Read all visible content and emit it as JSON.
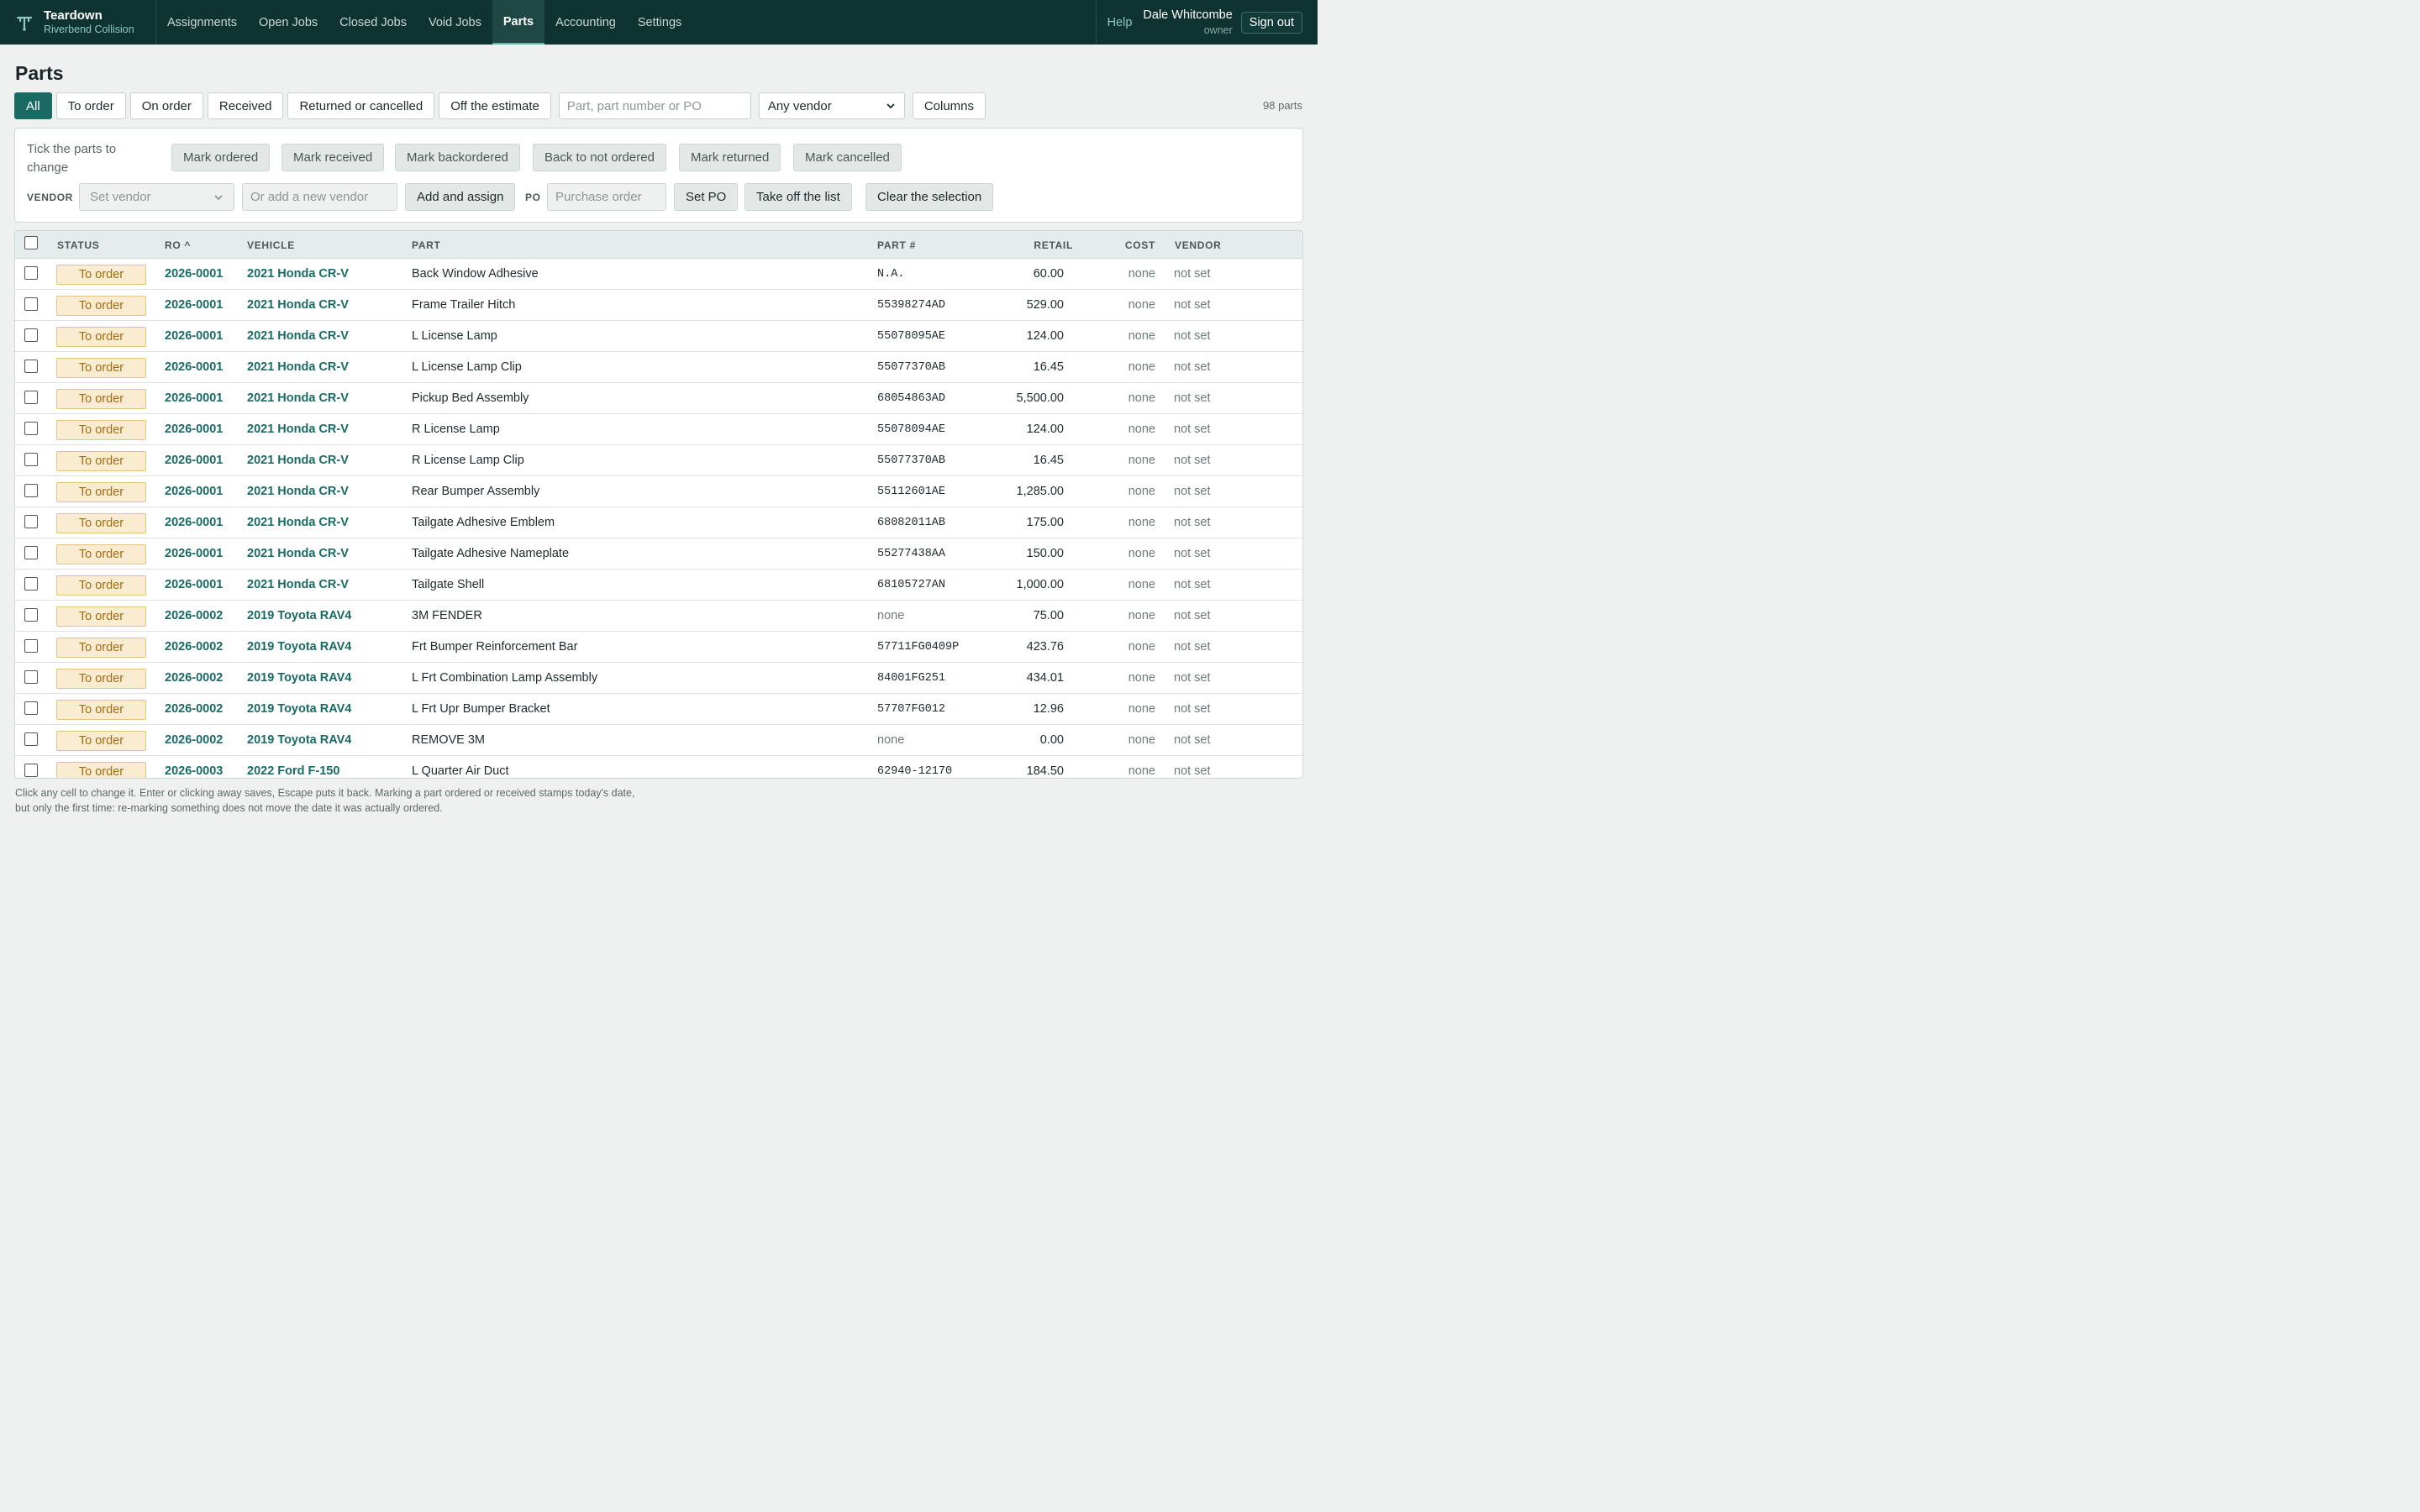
{
  "app": {
    "name": "Teardown",
    "shop": "Riverbend Collision"
  },
  "nav": [
    {
      "label": "Assignments",
      "active": false
    },
    {
      "label": "Open Jobs",
      "active": false
    },
    {
      "label": "Closed Jobs",
      "active": false
    },
    {
      "label": "Void Jobs",
      "active": false
    },
    {
      "label": "Parts",
      "active": true
    },
    {
      "label": "Accounting",
      "active": false
    },
    {
      "label": "Settings",
      "active": false
    }
  ],
  "topright": {
    "help": "Help",
    "user_name": "Dale Whitcombe",
    "user_role": "owner",
    "sign_out": "Sign out"
  },
  "page_title": "Parts",
  "filters": {
    "tabs": [
      "All",
      "To order",
      "On order",
      "Received",
      "Returned or cancelled",
      "Off the estimate"
    ],
    "active_tab": "All",
    "search_placeholder": "Part, part number or PO",
    "vendor_select": "Any vendor",
    "columns_button": "Columns",
    "count": "98 parts"
  },
  "bulk": {
    "hint": "Tick the parts to change",
    "actions": [
      "Mark ordered",
      "Mark received",
      "Mark backordered",
      "Back to not ordered",
      "Mark returned",
      "Mark cancelled"
    ],
    "vendor_label": "VENDOR",
    "set_vendor_placeholder": "Set vendor",
    "new_vendor_placeholder": "Or add a new vendor",
    "add_assign": "Add and assign",
    "po_label": "PO",
    "po_placeholder": "Purchase order",
    "set_po": "Set PO",
    "take_off": "Take off the list",
    "clear": "Clear the selection"
  },
  "table": {
    "headers": {
      "status": "STATUS",
      "ro": "RO ^",
      "vehicle": "VEHICLE",
      "part": "PART",
      "part_no": "PART #",
      "retail": "RETAIL",
      "cost": "COST",
      "vendor": "VENDOR"
    },
    "rows": [
      {
        "status": "To order",
        "ro": "2026-0001",
        "vehicle": "2021 Honda CR-V",
        "part": "Back Window Adhesive",
        "part_no": "N.A.",
        "retail": "60.00",
        "cost": "none",
        "vendor": "not set"
      },
      {
        "status": "To order",
        "ro": "2026-0001",
        "vehicle": "2021 Honda CR-V",
        "part": "Frame Trailer Hitch",
        "part_no": "55398274AD",
        "retail": "529.00",
        "cost": "none",
        "vendor": "not set"
      },
      {
        "status": "To order",
        "ro": "2026-0001",
        "vehicle": "2021 Honda CR-V",
        "part": "L License Lamp",
        "part_no": "55078095AE",
        "retail": "124.00",
        "cost": "none",
        "vendor": "not set"
      },
      {
        "status": "To order",
        "ro": "2026-0001",
        "vehicle": "2021 Honda CR-V",
        "part": "L License Lamp Clip",
        "part_no": "55077370AB",
        "retail": "16.45",
        "cost": "none",
        "vendor": "not set"
      },
      {
        "status": "To order",
        "ro": "2026-0001",
        "vehicle": "2021 Honda CR-V",
        "part": "Pickup Bed Assembly",
        "part_no": "68054863AD",
        "retail": "5,500.00",
        "cost": "none",
        "vendor": "not set"
      },
      {
        "status": "To order",
        "ro": "2026-0001",
        "vehicle": "2021 Honda CR-V",
        "part": "R License Lamp",
        "part_no": "55078094AE",
        "retail": "124.00",
        "cost": "none",
        "vendor": "not set"
      },
      {
        "status": "To order",
        "ro": "2026-0001",
        "vehicle": "2021 Honda CR-V",
        "part": "R License Lamp Clip",
        "part_no": "55077370AB",
        "retail": "16.45",
        "cost": "none",
        "vendor": "not set"
      },
      {
        "status": "To order",
        "ro": "2026-0001",
        "vehicle": "2021 Honda CR-V",
        "part": "Rear Bumper Assembly",
        "part_no": "55112601AE",
        "retail": "1,285.00",
        "cost": "none",
        "vendor": "not set"
      },
      {
        "status": "To order",
        "ro": "2026-0001",
        "vehicle": "2021 Honda CR-V",
        "part": "Tailgate Adhesive Emblem",
        "part_no": "68082011AB",
        "retail": "175.00",
        "cost": "none",
        "vendor": "not set"
      },
      {
        "status": "To order",
        "ro": "2026-0001",
        "vehicle": "2021 Honda CR-V",
        "part": "Tailgate Adhesive Nameplate",
        "part_no": "55277438AA",
        "retail": "150.00",
        "cost": "none",
        "vendor": "not set"
      },
      {
        "status": "To order",
        "ro": "2026-0001",
        "vehicle": "2021 Honda CR-V",
        "part": "Tailgate Shell",
        "part_no": "68105727AN",
        "retail": "1,000.00",
        "cost": "none",
        "vendor": "not set"
      },
      {
        "status": "To order",
        "ro": "2026-0002",
        "vehicle": "2019 Toyota RAV4",
        "part": "3M FENDER",
        "part_no": "none",
        "retail": "75.00",
        "cost": "none",
        "vendor": "not set"
      },
      {
        "status": "To order",
        "ro": "2026-0002",
        "vehicle": "2019 Toyota RAV4",
        "part": "Frt Bumper Reinforcement Bar",
        "part_no": "57711FG0409P",
        "retail": "423.76",
        "cost": "none",
        "vendor": "not set"
      },
      {
        "status": "To order",
        "ro": "2026-0002",
        "vehicle": "2019 Toyota RAV4",
        "part": "L Frt Combination Lamp Assembly",
        "part_no": "84001FG251",
        "retail": "434.01",
        "cost": "none",
        "vendor": "not set"
      },
      {
        "status": "To order",
        "ro": "2026-0002",
        "vehicle": "2019 Toyota RAV4",
        "part": "L Frt Upr Bumper Bracket",
        "part_no": "57707FG012",
        "retail": "12.96",
        "cost": "none",
        "vendor": "not set"
      },
      {
        "status": "To order",
        "ro": "2026-0002",
        "vehicle": "2019 Toyota RAV4",
        "part": "REMOVE 3M",
        "part_no": "none",
        "retail": "0.00",
        "cost": "none",
        "vendor": "not set"
      },
      {
        "status": "To order",
        "ro": "2026-0003",
        "vehicle": "2022 Ford F-150",
        "part": "L Quarter Air Duct",
        "part_no": "62940-12170",
        "retail": "184.50",
        "cost": "none",
        "vendor": "not set"
      }
    ]
  },
  "footnote": [
    "Click any cell to change it. Enter or clicking away saves, Escape puts it back. Marking a part ordered or received stamps today's date,",
    "but only the first time: re-marking something does not move the date it was actually ordered."
  ]
}
